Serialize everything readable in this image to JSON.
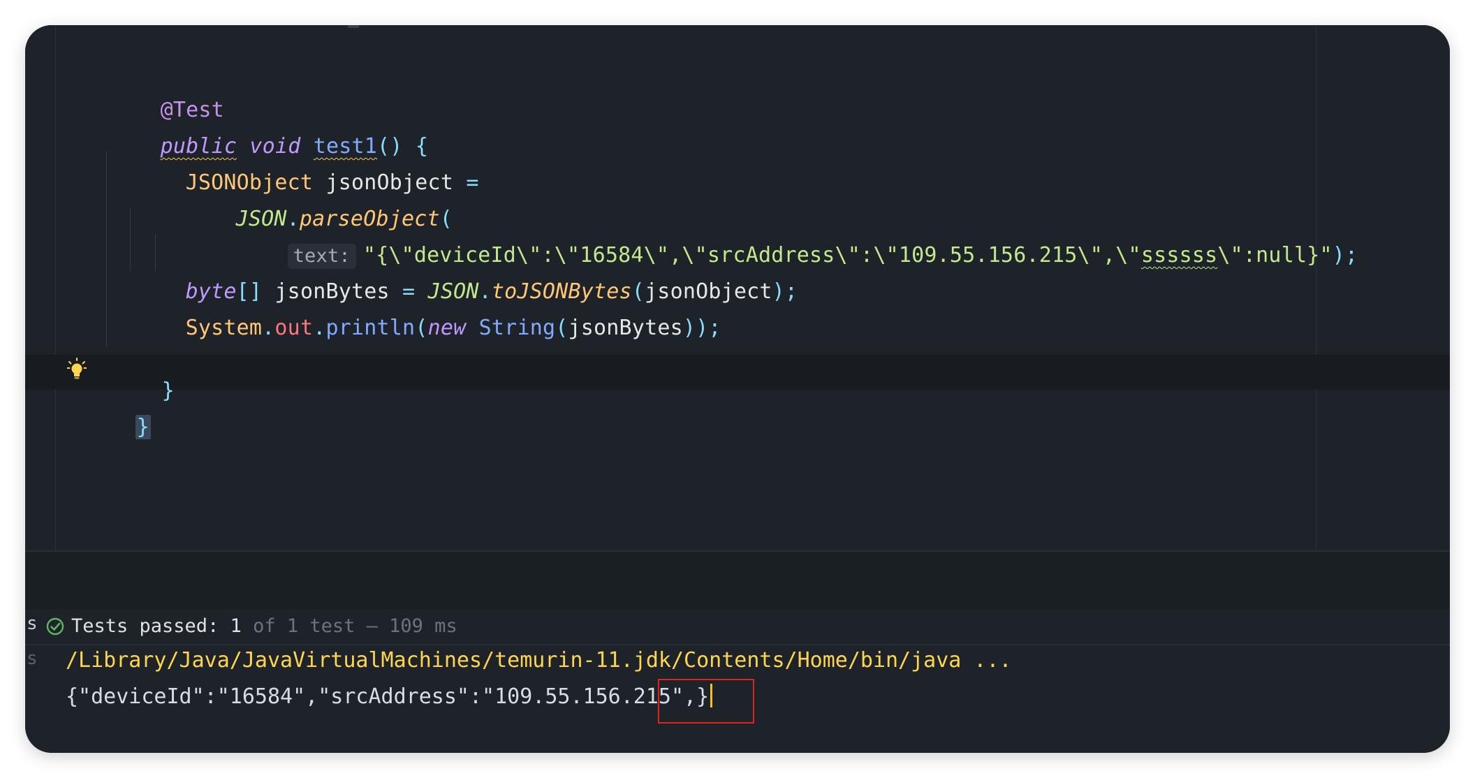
{
  "editor": {
    "annotation": "@Test",
    "method_modifier": "public",
    "method_return": "void",
    "method_name": "test1",
    "method_sig_tail": "() {",
    "line3_type": "JSONObject",
    "line3_var": " jsonObject ",
    "line3_eq": "=",
    "line4_class": "JSON",
    "line4_dot": ".",
    "line4_method": "parseObject",
    "line4_paren": "(",
    "line5_hint": "text:",
    "line5_str_a": "\"{\\\"deviceId\\\":\\\"16584\\\",\\\"srcAddress\\\":\\\"109.55.156.215\\\",\\\"",
    "line5_str_b": "ssssss",
    "line5_str_c": "\\\":null}\"",
    "line5_tail": ");",
    "line6_type": "byte",
    "line6_br": "[]",
    "line6_var": " jsonBytes ",
    "line6_eq": "= ",
    "line6_class": "JSON",
    "line6_dot": ".",
    "line6_method": "toJSONBytes",
    "line6_open": "(",
    "line6_arg": "jsonObject",
    "line6_close": ");",
    "line7_sys": "System",
    "line7_dot1": ".",
    "line7_out": "out",
    "line7_dot2": ".",
    "line7_println": "println",
    "line7_open": "(",
    "line7_new": "new",
    "line7_string": "String",
    "line7_open2": "(",
    "line7_arg": "jsonBytes",
    "line7_close": "));",
    "line8_brace": "}",
    "line9_brace": "}"
  },
  "console": {
    "side_letter_1": "s",
    "side_letter_2": "s",
    "tests_passed_label": "Tests passed: ",
    "tests_passed_count": "1",
    "tests_detail": " of 1 test – 109 ms",
    "path_line": "/Library/Java/JavaVirtualMachines/temurin-11.jdk/Contents/Home/bin/java ...",
    "output_line": "{\"deviceId\":\"16584\",\"srcAddress\":\"109.55.156.215\",}"
  },
  "colors": {
    "background": "#1e2329",
    "highlight_box": "#e0241b",
    "caret": "#ffc107",
    "success": "#5fb760"
  },
  "icons": {
    "status": "check-circle-icon",
    "intention": "lightbulb-icon"
  }
}
